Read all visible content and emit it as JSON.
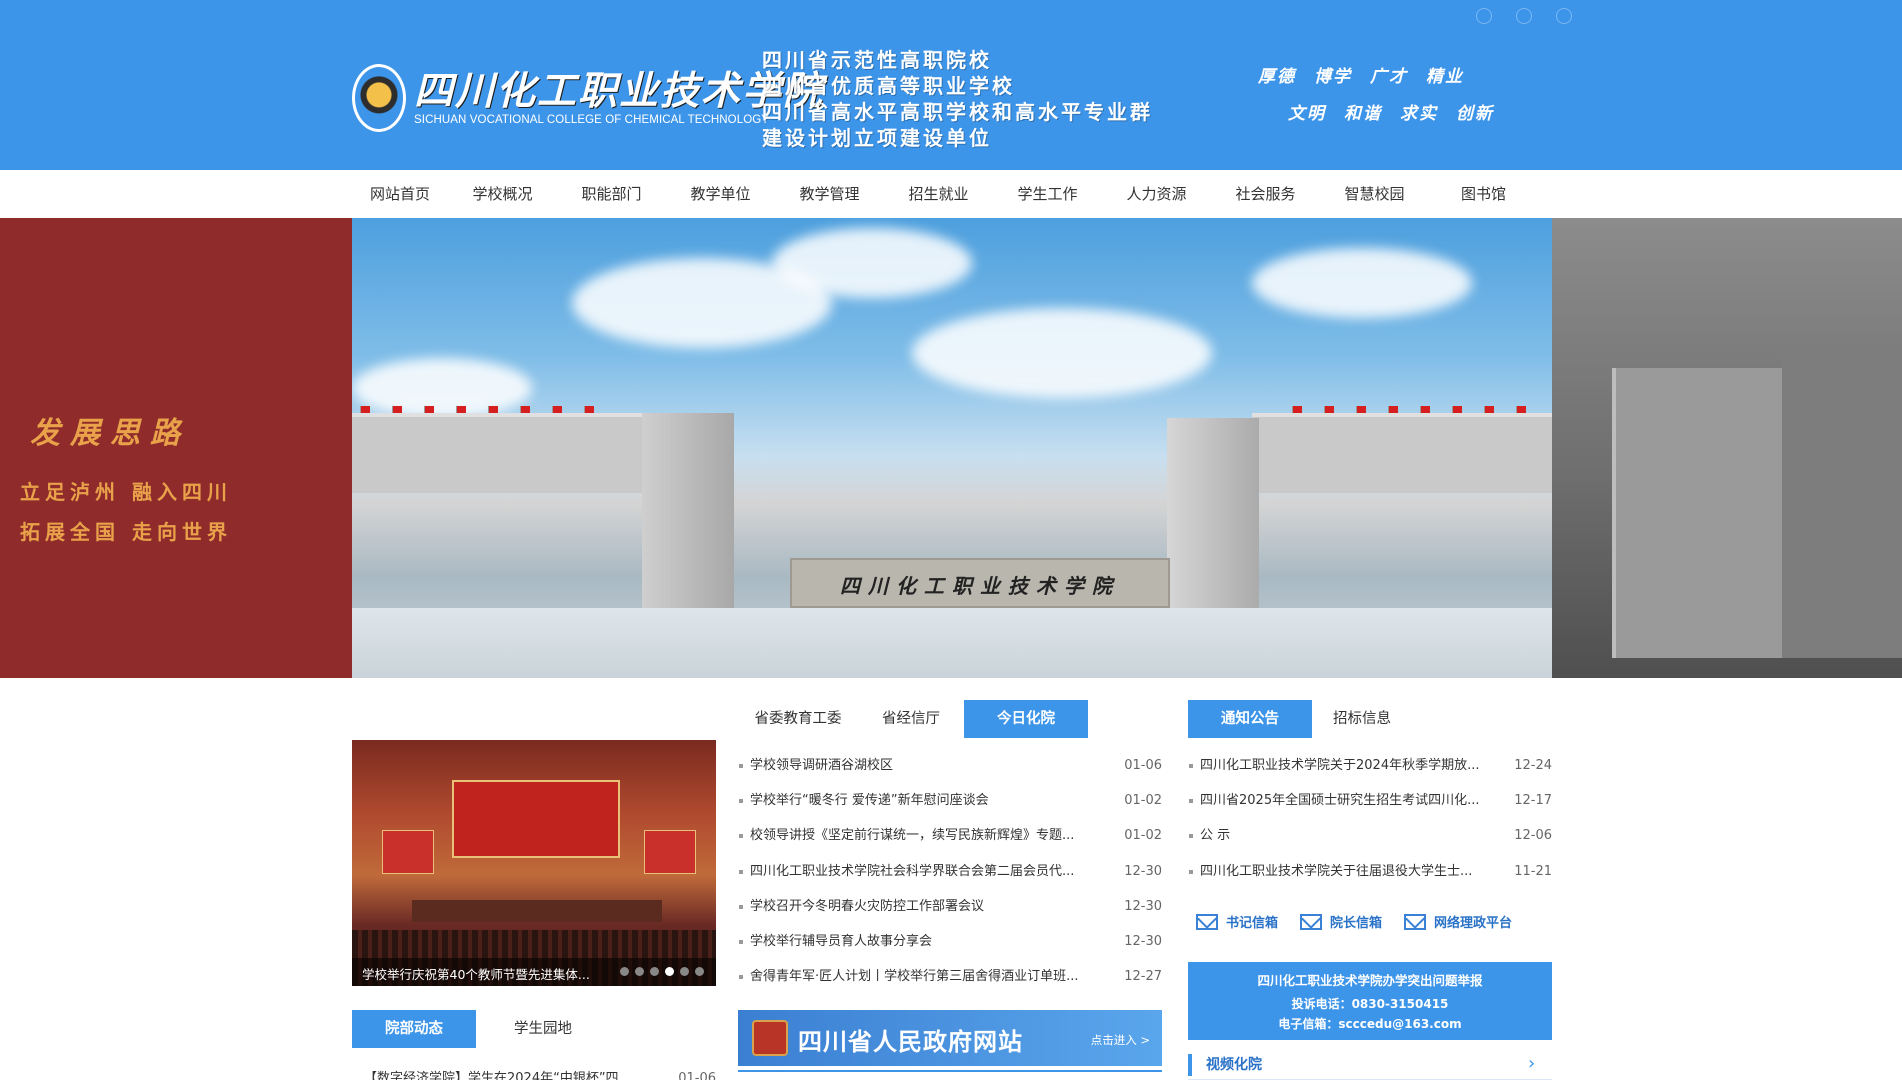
{
  "header": {
    "logo_cn": "四川化工职业技术学院",
    "logo_en": "SICHUAN VOCATIONAL COLLEGE OF CHEMICAL TECHNOLOGY",
    "honors": [
      "四川省示范性高职院校",
      "四川省优质高等职业学校",
      "四川省高水平高职学校和高水平专业群",
      "建设计划立项建设单位"
    ],
    "motto_row1": [
      "厚德",
      "博学",
      "广才",
      "精业"
    ],
    "motto_row2": [
      "文明",
      "和谐",
      "求实",
      "创新"
    ]
  },
  "nav": {
    "items": [
      "网站首页",
      "学校概况",
      "职能部门",
      "教学单位",
      "教学管理",
      "招生就业",
      "学生工作",
      "人力资源",
      "社会服务",
      "智慧校园",
      "图书馆"
    ]
  },
  "banner": {
    "left_title": "发展思路",
    "left_line1": "立足泸州  融入四川",
    "left_line2": "拓展全国  走向世界",
    "stone_text": "四川化工职业技术学院"
  },
  "photo_news": {
    "caption": "学校举行庆祝第40个教师节暨先进集体...",
    "dots": 6,
    "active_dot": 3
  },
  "news_tabs": {
    "tabs": [
      "省委教育工委",
      "省经信厅",
      "今日化院"
    ],
    "active": 2
  },
  "news_list": [
    {
      "title": "学校领导调研酒谷湖校区",
      "date": "01-06"
    },
    {
      "title": "学校举行“暖冬行 爱传递”新年慰问座谈会",
      "date": "01-02"
    },
    {
      "title": "校领导讲授《坚定前行谋统一，续写民族新辉煌》专题...",
      "date": "01-02"
    },
    {
      "title": "四川化工职业技术学院社会科学界联合会第二届会员代...",
      "date": "12-30"
    },
    {
      "title": "学校召开今冬明春火灾防控工作部署会议",
      "date": "12-30"
    },
    {
      "title": "学校举行辅导员育人故事分享会",
      "date": "12-30"
    },
    {
      "title": "舍得青年军·匠人计划丨学校举行第三届舍得酒业订单班...",
      "date": "12-27"
    }
  ],
  "notice_tabs": {
    "tabs": [
      "通知公告",
      "招标信息"
    ],
    "active": 0
  },
  "notice_list": [
    {
      "title": "四川化工职业技术学院关于2024年秋季学期放...",
      "date": "12-24"
    },
    {
      "title": "四川省2025年全国硕士研究生招生考试四川化...",
      "date": "12-17"
    },
    {
      "title": "公 示",
      "date": "12-06"
    },
    {
      "title": "四川化工职业技术学院关于往届退役大学生士...",
      "date": "11-21"
    }
  ],
  "mailboxes": [
    "书记信箱",
    "院长信箱",
    "网络理政平台"
  ],
  "report": {
    "title": "四川化工职业技术学院办学突出问题举报",
    "phone": "投诉电话：0830-3150415",
    "email": "电子信箱：scccedu@163.com"
  },
  "video": {
    "label": "视频化院"
  },
  "gov_banner": {
    "title": "四川省人民政府网站",
    "enter": "点击进入 >"
  },
  "dept_tabs": {
    "tabs": [
      "院部动态",
      "学生园地"
    ],
    "active": 0
  },
  "dept_list": [
    {
      "title": "【数字经济学院】学生在2024年“中银杯”四...",
      "date": "01-06"
    }
  ],
  "colors": {
    "header_blue": "#3d95ea",
    "banner_red": "#8f2b2b",
    "banner_gold": "#e9a24a"
  }
}
